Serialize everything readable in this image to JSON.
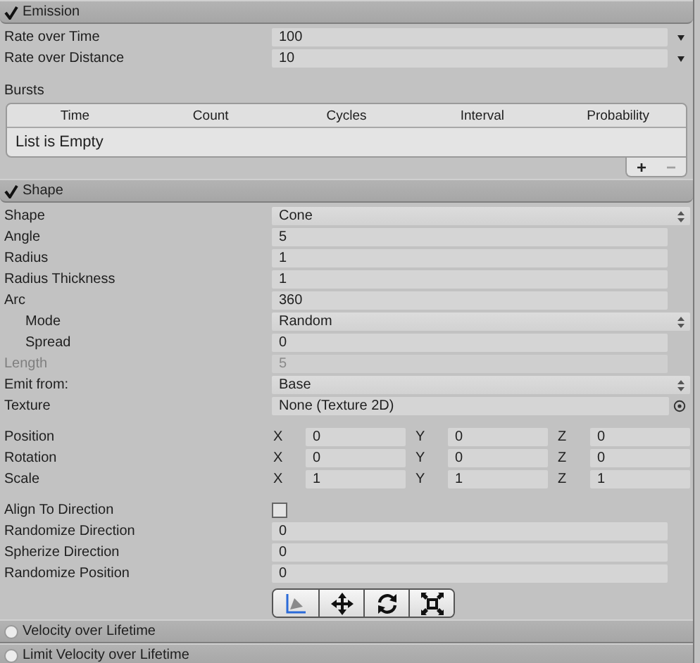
{
  "modules": [
    {
      "title": "Emission",
      "enabled": true,
      "expanded": true,
      "kind": "emission",
      "rows": [
        {
          "kind": "number",
          "label": "Rate over Time",
          "value": "100",
          "curve_menu": true
        },
        {
          "kind": "number",
          "label": "Rate over Distance",
          "value": "10",
          "curve_menu": true
        }
      ],
      "bursts": {
        "label": "Bursts",
        "columns": [
          "Time",
          "Count",
          "Cycles",
          "Interval",
          "Probability"
        ],
        "empty_text": "List is Empty",
        "buttons": [
          {
            "label": "+",
            "disabled": false
          },
          {
            "label": "−",
            "disabled": true
          }
        ]
      }
    },
    {
      "title": "Shape",
      "enabled": true,
      "expanded": true,
      "kind": "shape",
      "groups": [
        [
          {
            "kind": "dropdown",
            "label": "Shape",
            "value": "Cone"
          },
          {
            "kind": "number",
            "label": "Angle",
            "value": "5"
          },
          {
            "kind": "number",
            "label": "Radius",
            "value": "1"
          },
          {
            "kind": "number",
            "label": "Radius Thickness",
            "value": "1"
          },
          {
            "kind": "number",
            "label": "Arc",
            "value": "360",
            "children": [
              {
                "kind": "dropdown",
                "label": "Mode",
                "value": "Random"
              },
              {
                "kind": "number",
                "label": "Spread",
                "value": "0"
              }
            ]
          },
          {
            "kind": "number",
            "label": "Length",
            "value": "5",
            "disabled": true
          },
          {
            "kind": "dropdown",
            "label": "Emit from:",
            "value": "Base"
          },
          {
            "kind": "object",
            "label": "Texture",
            "value": "None (Texture 2D)"
          }
        ],
        [
          {
            "kind": "vector",
            "label": "Position",
            "components": [
              {
                "axis": "X",
                "value": "0"
              },
              {
                "axis": "Y",
                "value": "0"
              },
              {
                "axis": "Z",
                "value": "0"
              }
            ]
          },
          {
            "kind": "vector",
            "label": "Rotation",
            "components": [
              {
                "axis": "X",
                "value": "0"
              },
              {
                "axis": "Y",
                "value": "0"
              },
              {
                "axis": "Z",
                "value": "0"
              }
            ]
          },
          {
            "kind": "vector",
            "label": "Scale",
            "components": [
              {
                "axis": "X",
                "value": "1"
              },
              {
                "axis": "Y",
                "value": "1"
              },
              {
                "axis": "Z",
                "value": "1"
              }
            ]
          }
        ],
        [
          {
            "kind": "checkbox",
            "label": "Align To Direction",
            "checked": false
          },
          {
            "kind": "number",
            "label": "Randomize Direction",
            "value": "0"
          },
          {
            "kind": "number",
            "label": "Spherize Direction",
            "value": "0"
          },
          {
            "kind": "number",
            "label": "Randomize Position",
            "value": "0"
          }
        ]
      ],
      "tools": [
        {
          "kind": "edit-shape"
        },
        {
          "kind": "move"
        },
        {
          "kind": "rotate"
        },
        {
          "kind": "scale"
        }
      ]
    },
    {
      "title": "Velocity over Lifetime",
      "enabled": false,
      "expanded": false
    },
    {
      "title": "Limit Velocity over Lifetime",
      "enabled": false,
      "expanded": false
    }
  ]
}
